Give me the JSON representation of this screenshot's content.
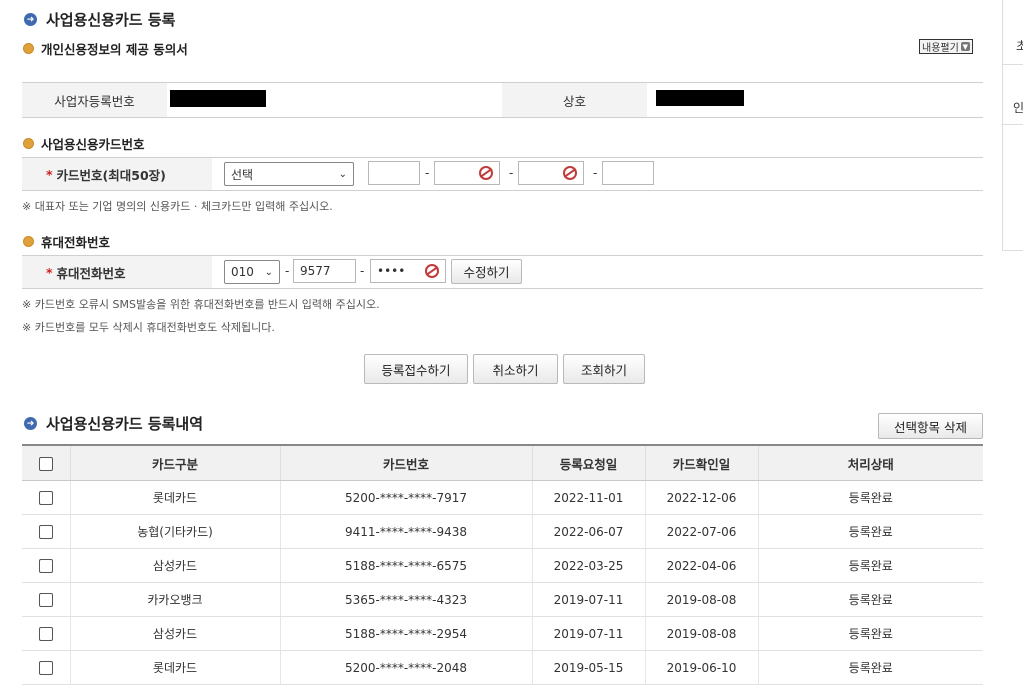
{
  "page": {
    "title": "사업용신용카드 등록",
    "consent_title": "개인신용정보의 제공 동의서",
    "consent_toggle": "내용펼기"
  },
  "biz_info": {
    "reg_no_label": "사업자등록번호",
    "name_label": "상호"
  },
  "card_section": {
    "title": "사업용신용카드번호",
    "field_label": "카드번호(최대50장)",
    "select_value": "선택",
    "note": "※ 대표자 또는 기업 명의의 신용카드 · 체크카드만 입력해 주십시오."
  },
  "phone_section": {
    "title": "휴대전화번호",
    "field_label": "휴대전화번호",
    "prefix": "010",
    "middle": "9577",
    "last_masked": "••••",
    "edit_button": "수정하기",
    "note1": "※ 카드번호 오류시 SMS발송을 위한 휴대전화번호를 반드시 입력해 주십시오.",
    "note2": "※ 카드번호를 모두 삭제시 휴대전화번호도 삭제됩니다."
  },
  "actions": {
    "submit": "등록접수하기",
    "cancel": "취소하기",
    "inquire": "조회하기"
  },
  "list": {
    "title": "사업용신용카드 등록내역",
    "delete_button": "선택항목 삭제",
    "headers": [
      "카드구분",
      "카드번호",
      "등록요청일",
      "카드확인일",
      "처리상태"
    ],
    "rows": [
      {
        "company": "롯데카드",
        "card": "5200-****-****-7917",
        "req": "2022-11-01",
        "conf": "2022-12-06",
        "status": "등록완료"
      },
      {
        "company": "농협(기타카드)",
        "card": "9411-****-****-9438",
        "req": "2022-06-07",
        "conf": "2022-07-06",
        "status": "등록완료"
      },
      {
        "company": "삼성카드",
        "card": "5188-****-****-6575",
        "req": "2022-03-25",
        "conf": "2022-04-06",
        "status": "등록완료"
      },
      {
        "company": "카카오뱅크",
        "card": "5365-****-****-4323",
        "req": "2019-07-11",
        "conf": "2019-08-08",
        "status": "등록완료"
      },
      {
        "company": "삼성카드",
        "card": "5188-****-****-2954",
        "req": "2019-07-11",
        "conf": "2019-08-08",
        "status": "등록완료"
      },
      {
        "company": "롯데카드",
        "card": "5200-****-****-2048",
        "req": "2019-05-15",
        "conf": "2019-06-10",
        "status": "등록완료"
      }
    ]
  },
  "side_panel": {
    "item1": "초",
    "item2": "인"
  }
}
